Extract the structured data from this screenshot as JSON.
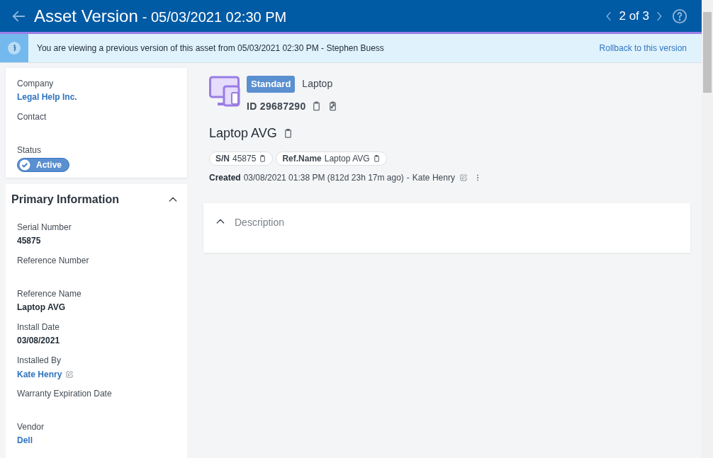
{
  "header": {
    "title": "Asset Version",
    "subtitle": "- 05/03/2021 02:30 PM",
    "pager": "2 of 3"
  },
  "banner": {
    "message": "You are viewing a previous version of this asset from 05/03/2021 02:30 PM - Stephen Buess",
    "action": "Rollback to this version"
  },
  "summary_card": {
    "fields": [
      {
        "label": "Company",
        "value": "Legal Help Inc.",
        "kind": "link"
      },
      {
        "label": "Contact",
        "kind": "empty"
      },
      {
        "label": "Status",
        "value": "Active",
        "kind": "status"
      }
    ]
  },
  "primary_information": {
    "title": "Primary Information",
    "expanded": true,
    "fields": [
      {
        "label": "Serial Number",
        "value": "45875",
        "kind": "text"
      },
      {
        "label": "Reference Number",
        "kind": "empty"
      },
      {
        "label": "Reference Name",
        "value": "Laptop AVG",
        "kind": "text"
      },
      {
        "label": "Install Date",
        "value": "03/08/2021",
        "kind": "text"
      },
      {
        "label": "Installed By",
        "value": "Kate Henry",
        "kind": "link_edit"
      },
      {
        "label": "Warranty Expiration Date",
        "kind": "empty"
      },
      {
        "label": "Vendor",
        "value": "Dell",
        "kind": "link"
      }
    ]
  },
  "asset": {
    "tier": "Standard",
    "type": "Laptop",
    "id": "ID 29687290",
    "name": "Laptop AVG",
    "chips": [
      {
        "label": "S/N",
        "value": "45875"
      },
      {
        "label": "Ref.Name",
        "value": "Laptop AVG"
      }
    ],
    "created": {
      "label": "Created",
      "when": "03/08/2021 01:38 PM (812d 23h 17m ago)",
      "separator": "-",
      "by": "Kate Henry"
    }
  },
  "description": {
    "title": "Description",
    "expanded": true
  }
}
